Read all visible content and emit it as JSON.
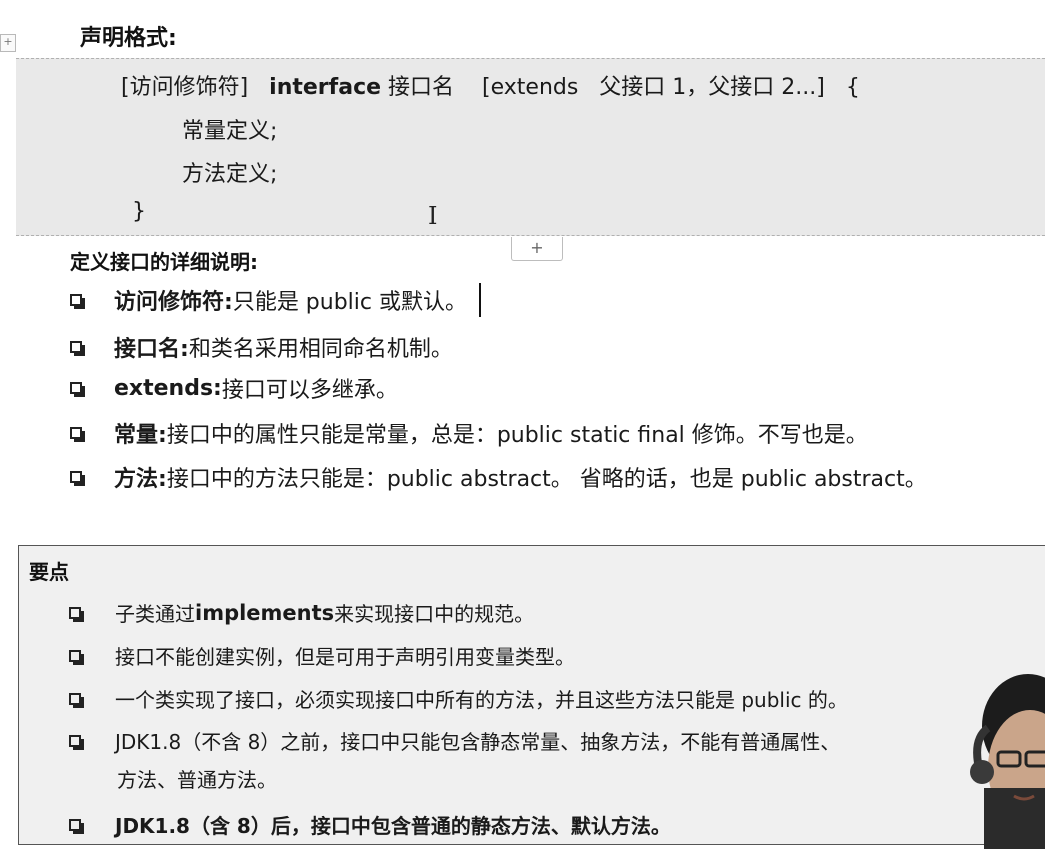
{
  "header": {
    "title": "声明格式:"
  },
  "syntax": {
    "line1": {
      "modifier": "[访问修饰符]",
      "keyword": "interface",
      "name": "接口名",
      "extends_part": "[extends   父接口 1，父接口 2...]",
      "brace": "{"
    },
    "line2": "常量定义;",
    "line3": "方法定义;",
    "close": "}"
  },
  "details": {
    "title": "定义接口的详细说明:",
    "items": [
      {
        "key": "访问修饰符:",
        "text": " 只能是 public 或默认。"
      },
      {
        "key": "接口名:",
        "text": " 和类名采用相同命名机制。"
      },
      {
        "key": "extends:",
        "text": " 接口可以多继承。"
      },
      {
        "key": "常量:",
        "text": " 接口中的属性只能是常量，总是：public static final  修饰。不写也是。"
      },
      {
        "key": "方法:",
        "text": " 接口中的方法只能是：public abstract。 省略的话，也是 public abstract。"
      }
    ]
  },
  "key_points": {
    "title": "要点",
    "items": [
      {
        "pre": "子类通过 ",
        "bold": "implements",
        "post": " 来实现接口中的规范。"
      },
      {
        "text": "接口不能创建实例，但是可用于声明引用变量类型。"
      },
      {
        "text": "一个类实现了接口，必须实现接口中所有的方法，并且这些方法只能是 public 的。"
      },
      {
        "text": "JDK1.8（不含 8）之前，接口中只能包含静态常量、抽象方法，不能有普通属性、",
        "cont": "方法、普通方法。"
      },
      {
        "bold_all": "JDK1.8（含 8）后，接口中包含普通的静态方法、默认方法。"
      }
    ]
  },
  "controls": {
    "add_label": "+",
    "move_label": "+",
    "cursor_glyph": "I"
  }
}
